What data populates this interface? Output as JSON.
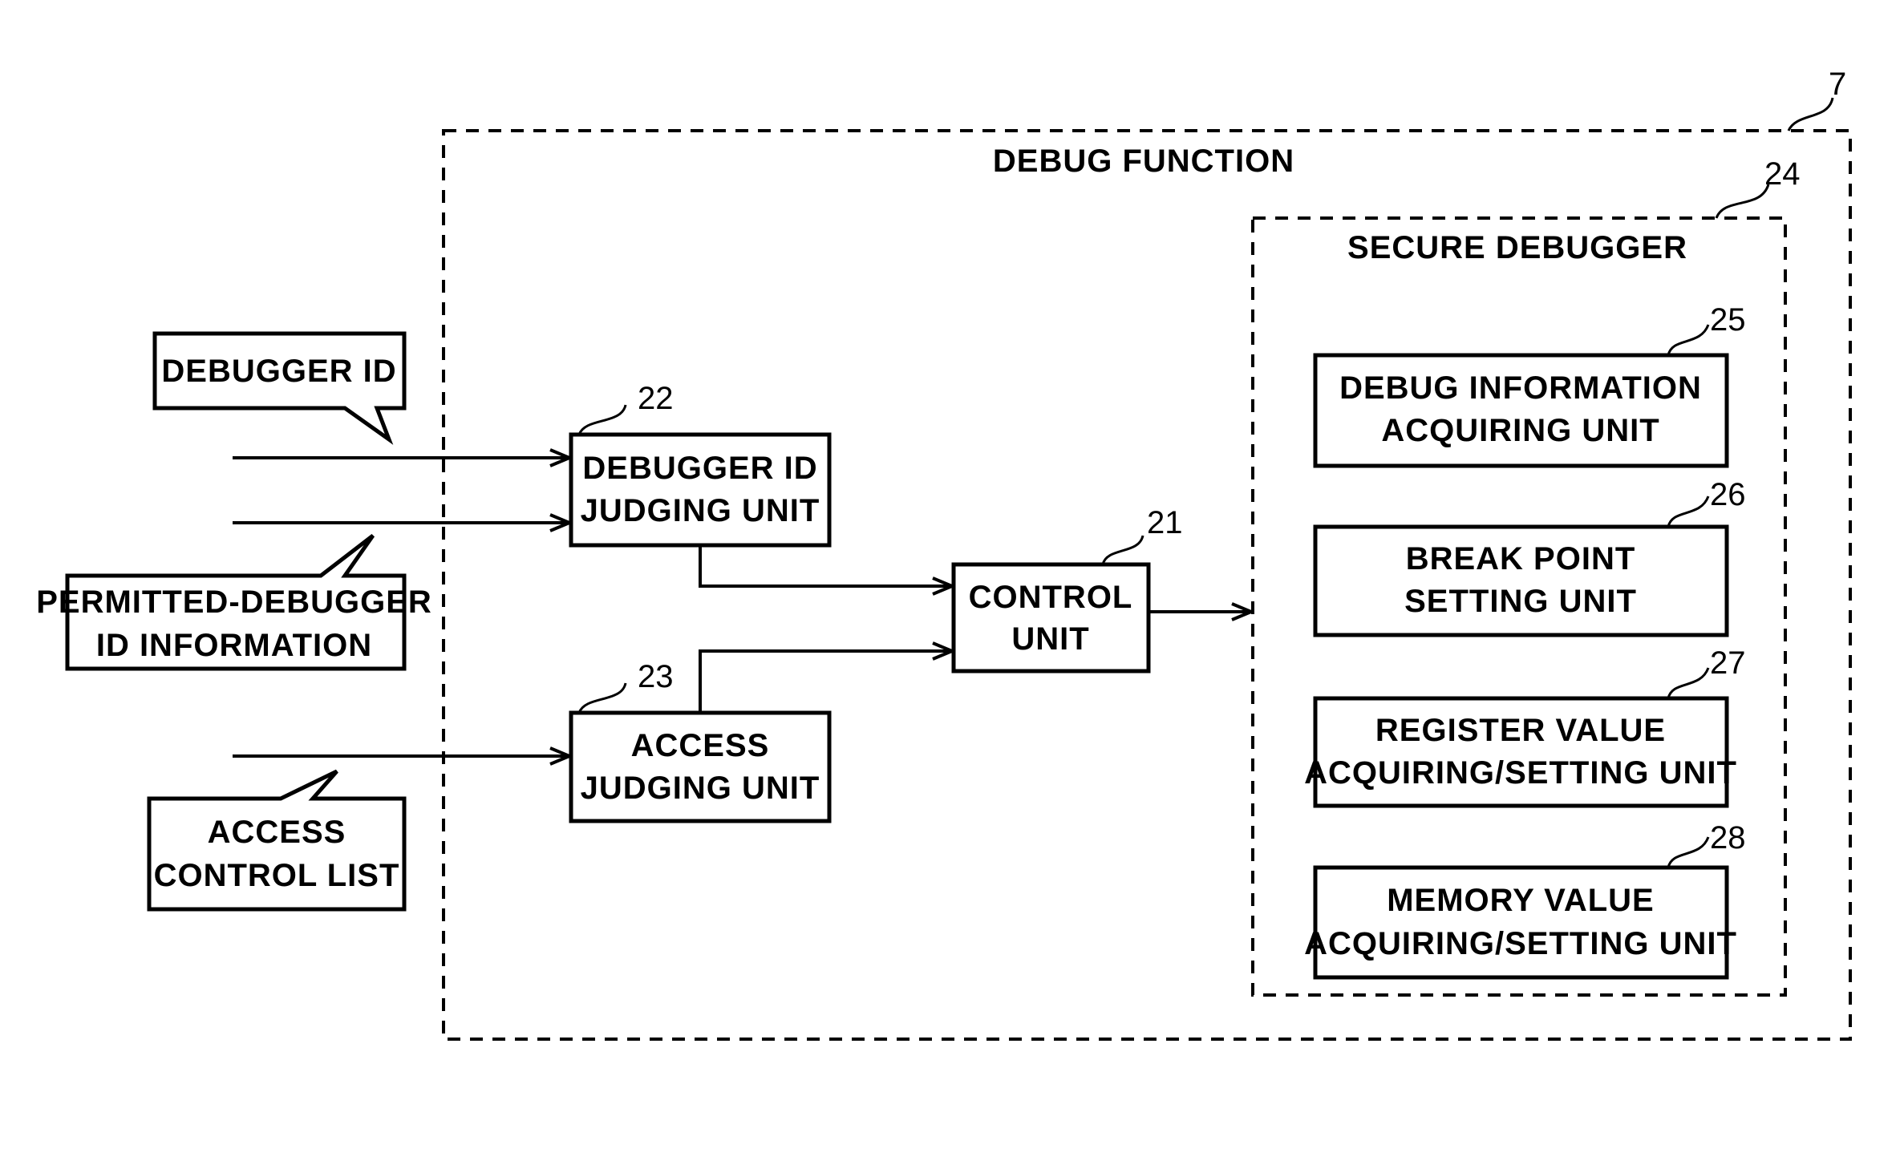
{
  "diagram": {
    "title": "DEBUG FUNCTION",
    "ref": "7",
    "secure_debugger": {
      "title": "SECURE DEBUGGER",
      "ref": "24",
      "units": [
        {
          "ref": "25",
          "line1": "DEBUG INFORMATION",
          "line2": "ACQUIRING UNIT"
        },
        {
          "ref": "26",
          "line1": "BREAK POINT",
          "line2": "SETTING UNIT"
        },
        {
          "ref": "27",
          "line1": "REGISTER VALUE",
          "line2": "ACQUIRING/SETTING UNIT"
        },
        {
          "ref": "28",
          "line1": "MEMORY VALUE",
          "line2": "ACQUIRING/SETTING UNIT"
        }
      ]
    },
    "debugger_id_judging": {
      "ref": "22",
      "line1": "DEBUGGER ID",
      "line2": "JUDGING UNIT"
    },
    "access_judging": {
      "ref": "23",
      "line1": "ACCESS",
      "line2": "JUDGING UNIT"
    },
    "control_unit": {
      "ref": "21",
      "line1": "CONTROL",
      "line2": "UNIT"
    },
    "inputs": {
      "debugger_id": {
        "line1": "DEBUGGER ID"
      },
      "permitted": {
        "line1": "PERMITTED-DEBUGGER",
        "line2": "ID INFORMATION"
      },
      "acl": {
        "line1": "ACCESS",
        "line2": "CONTROL LIST"
      }
    }
  }
}
